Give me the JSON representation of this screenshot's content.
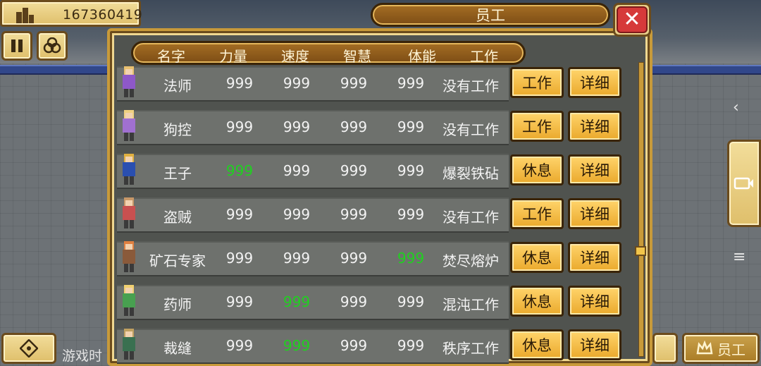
{
  "hud": {
    "money": "167360419",
    "bottom_left_text": "游戏时",
    "bottom_right_label": "员工",
    "side_glyph_back": "‹",
    "side_glyph_menu": "≡",
    "icons": [
      "building-icon",
      "pause-icon",
      "coins-icon",
      "dpad-icon",
      "crown-icon",
      "camera-icon"
    ]
  },
  "dialog": {
    "title": "员工",
    "close_symbol": "✕",
    "columns": [
      "名字",
      "力量",
      "速度",
      "智慧",
      "体能",
      "工作"
    ]
  },
  "staff": [
    {
      "name": "法师",
      "power": "999",
      "speed": "999",
      "wisdom": "999",
      "stamina": "999",
      "job": "没有工作",
      "action": "工作",
      "detail": "详细",
      "highlight": []
    },
    {
      "name": "狗控",
      "power": "999",
      "speed": "999",
      "wisdom": "999",
      "stamina": "999",
      "job": "没有工作",
      "action": "工作",
      "detail": "详细",
      "highlight": []
    },
    {
      "name": "王子",
      "power": "999",
      "speed": "999",
      "wisdom": "999",
      "stamina": "999",
      "job": "爆裂铁砧",
      "action": "休息",
      "detail": "详细",
      "highlight": [
        "power"
      ]
    },
    {
      "name": "盗贼",
      "power": "999",
      "speed": "999",
      "wisdom": "999",
      "stamina": "999",
      "job": "没有工作",
      "action": "工作",
      "detail": "详细",
      "highlight": []
    },
    {
      "name": "矿石专家",
      "power": "999",
      "speed": "999",
      "wisdom": "999",
      "stamina": "999",
      "job": "焚尽熔炉",
      "action": "休息",
      "detail": "详细",
      "highlight": [
        "stamina"
      ]
    },
    {
      "name": "药师",
      "power": "999",
      "speed": "999",
      "wisdom": "999",
      "stamina": "999",
      "job": "混沌工作",
      "action": "休息",
      "detail": "详细",
      "highlight": [
        "speed"
      ]
    },
    {
      "name": "裁缝",
      "power": "999",
      "speed": "999",
      "wisdom": "999",
      "stamina": "999",
      "job": "秩序工作",
      "action": "休息",
      "detail": "详细",
      "highlight": [
        "speed"
      ]
    }
  ],
  "colors": {
    "stat_highlight": "#1fd11f",
    "button_gold": "#eaa92c",
    "frame_brown": "#7d4d15",
    "close_red": "#d63a3a"
  },
  "scroll": {
    "position_fraction": 0.65
  }
}
